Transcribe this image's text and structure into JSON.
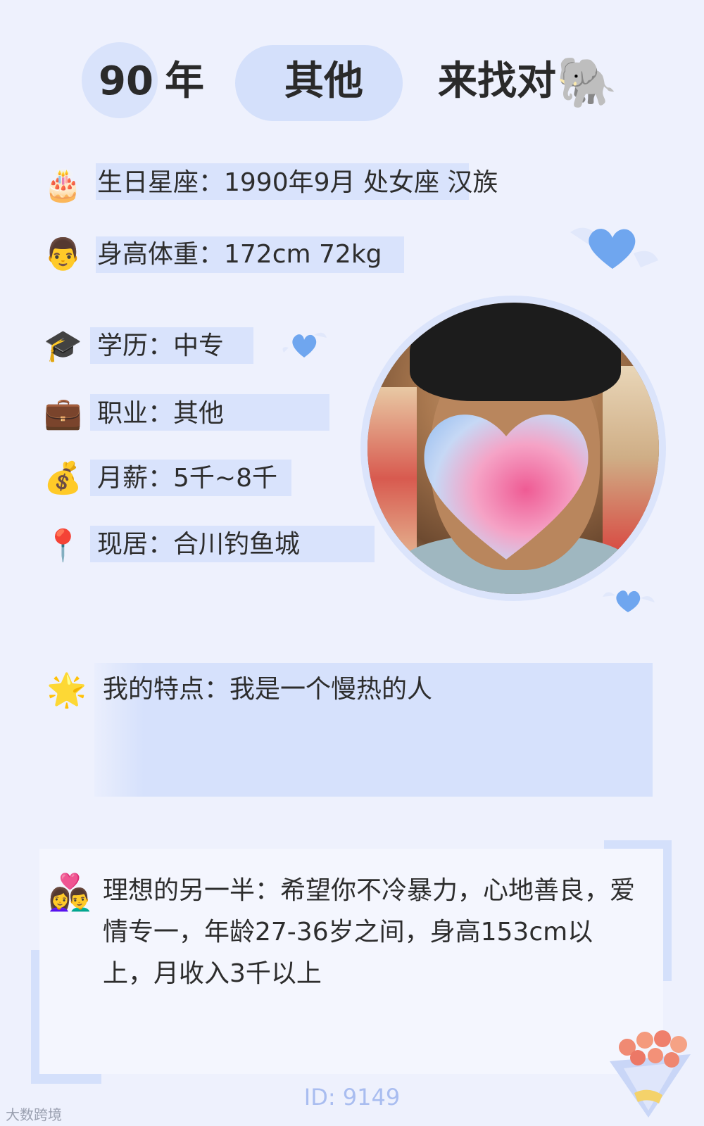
{
  "header": {
    "year_number": "90",
    "year_unit": "年",
    "occupation": "其他",
    "seeking": "来找对",
    "seeking_icon": "🐘"
  },
  "info": [
    {
      "icon": "🎂",
      "icon_name": "birthday-cake-icon",
      "text": "生日星座：1990年9月 处女座 汉族"
    },
    {
      "icon": "👨",
      "icon_name": "man-face-icon",
      "text": "身高体重：172cm 72kg"
    },
    {
      "icon": "🎓",
      "icon_name": "graduation-cap-icon",
      "text": "学历：中专"
    },
    {
      "icon": "💼",
      "icon_name": "briefcase-icon",
      "text": "职业：其他"
    },
    {
      "icon": "💰",
      "icon_name": "money-bag-icon",
      "text": "月薪：5千~8千"
    },
    {
      "icon": "📍",
      "icon_name": "location-pin-icon",
      "text": "现居：合川钓鱼城"
    }
  ],
  "traits": {
    "icon": "🌟",
    "text": "我的特点：我是一个慢热的人"
  },
  "ideal": {
    "icon": "👩‍❤️‍👨",
    "text": "理想的另一半：希望你不冷暴力，心地善良，爱情专一，年龄27-36岁之间，身高153cm以上，月收入3千以上"
  },
  "footer": {
    "id_text": "ID: 9149",
    "watermark": "大数跨境"
  },
  "colors": {
    "background": "#eef1fd",
    "highlight": "#d9e3fc",
    "accent_blue": "#6fa6ef"
  }
}
